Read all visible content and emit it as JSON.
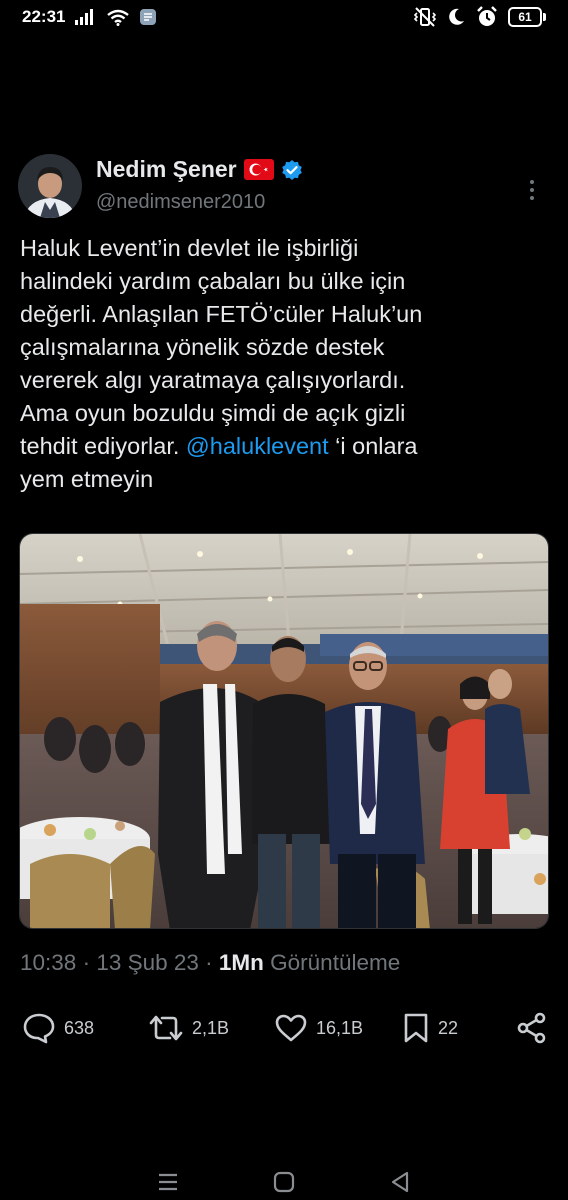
{
  "status_bar": {
    "time": "22:31",
    "battery": "61",
    "icons": [
      "signal-icon",
      "wifi-icon",
      "app-notification-icon",
      "vibrate-icon",
      "moon-icon",
      "alarm-icon",
      "battery-icon"
    ]
  },
  "tweet": {
    "author": {
      "display_name": "Nedim Şener",
      "handle": "@nedimsener2010",
      "flag": "turkey-flag-icon",
      "verified": true
    },
    "text_before_mention": "Haluk Levent’in devlet ile işbirliği\nhalindeki yardım çabaları bu ülke için\ndeğerli. Anlaşılan FETÖ’cüler Haluk’un\nçalışmalarına yönelik sözde destek\nvererek algı yaratmaya çalışıyorlardı.\nAma oyun bozuldu şimdi de açık gizli\ntehdit ediyorlar. ",
    "mention": "@haluklevent",
    "text_after_mention": " ‘i onlara\nyem etmeyin",
    "meta": {
      "time": "10:38",
      "separator": " · ",
      "date": "13 Şub 23",
      "separator2": " · ",
      "views_count": "1Mn",
      "views_label": " Görüntüleme"
    },
    "actions": {
      "reply_count": "638",
      "retweet_count": "2,1B",
      "like_count": "16,1B",
      "bookmark_count": "22"
    }
  },
  "colors": {
    "background": "#000000",
    "text": "#e7e9ea",
    "secondary": "#71767b",
    "accent": "#1d9bf0"
  }
}
